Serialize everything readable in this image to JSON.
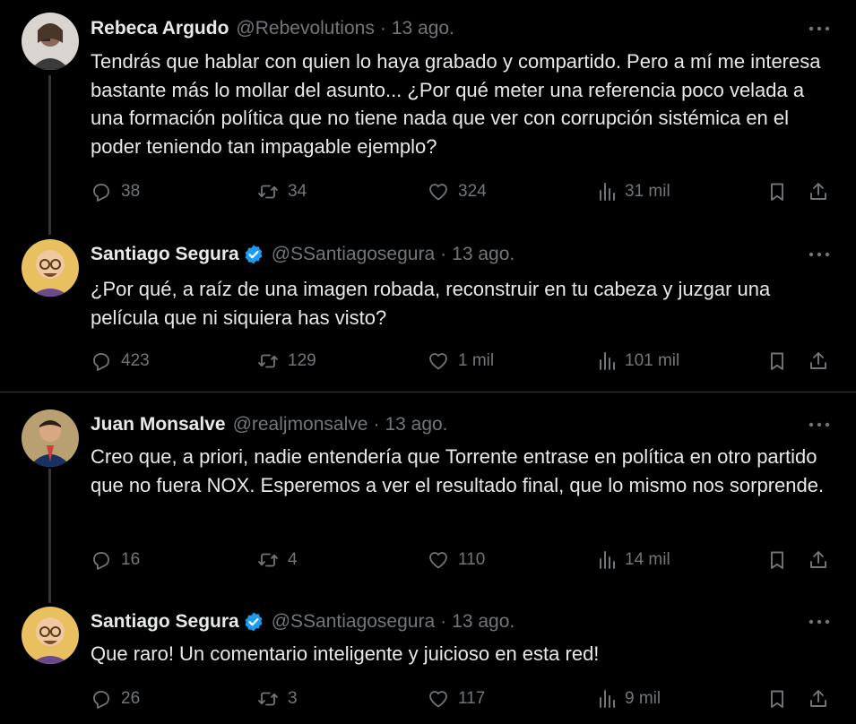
{
  "tweets": [
    {
      "name": "Rebeca Argudo",
      "verified": false,
      "handle": "@Rebevolutions",
      "sep": "·",
      "date": "13 ago.",
      "text": "Tendrás que hablar con quien lo haya grabado y compartido. Pero a mí me interesa bastante más lo mollar del asunto... ¿Por qué meter una referencia poco velada a una formación política que no tiene nada que ver con corrupción sistémica en el poder teniendo tan impagable ejemplo?",
      "replies": "38",
      "retweets": "34",
      "likes": "324",
      "views": "31 mil"
    },
    {
      "name": "Santiago Segura",
      "verified": true,
      "handle": "@SSantiagosegura",
      "sep": "·",
      "date": "13 ago.",
      "text": "¿Por qué, a raíz de una imagen robada, reconstruir en tu cabeza y juzgar una película que ni siquiera has visto?",
      "replies": "423",
      "retweets": "129",
      "likes": "1 mil",
      "views": "101 mil"
    },
    {
      "name": "Juan Monsalve",
      "verified": false,
      "handle": "@realjmonsalve",
      "sep": "·",
      "date": "13 ago.",
      "text": "Creo que, a priori, nadie entendería que Torrente entrase en política en otro partido que no fuera NOX. Esperemos a ver el resultado final, que lo mismo nos sorprende.",
      "replies": "16",
      "retweets": "4",
      "likes": "110",
      "views": "14 mil"
    },
    {
      "name": "Santiago Segura",
      "verified": true,
      "handle": "@SSantiagosegura",
      "sep": "·",
      "date": "13 ago.",
      "text": "Que raro! Un comentario inteligente y juicioso en esta red!",
      "replies": "26",
      "retweets": "3",
      "likes": "117",
      "views": "9 mil"
    }
  ],
  "colors": {
    "background": "#000000",
    "text": "#e7e9ea",
    "secondary": "#71767b",
    "verified": "#1d9bf0",
    "divider": "#2f3336"
  },
  "icons": [
    "more-icon",
    "verified-icon",
    "reply-icon",
    "retweet-icon",
    "like-icon",
    "views-icon",
    "bookmark-icon",
    "share-icon"
  ]
}
